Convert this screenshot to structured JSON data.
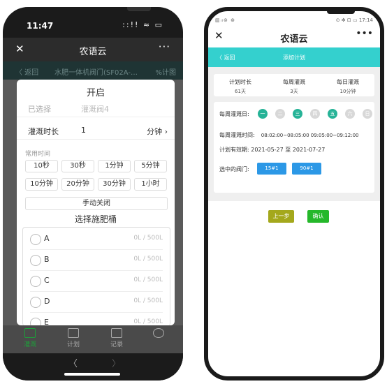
{
  "left": {
    "status": {
      "time": "11:47",
      "icons": "::!! ≈ ▭"
    },
    "titlebar": {
      "close": "✕",
      "title": "农语云",
      "more": "···"
    },
    "navbar": {
      "back": "〈 返回",
      "title": "水肥一体机阀门(SF02A-…",
      "right": "%计图"
    },
    "modal": {
      "title": "开启",
      "selected_label": "已选择",
      "selected_value": "灌溉阀4",
      "duration_label": "灌溉时长",
      "duration_value": "1",
      "duration_unit": "分钟",
      "common_time_label": "常用时间",
      "time_buttons": [
        "10秒",
        "30秒",
        "1分钟",
        "5分钟",
        "10分钟",
        "20分钟",
        "30分钟",
        "1小时"
      ],
      "manual_close": "手动关闭",
      "choose_tank": "选择施肥桶",
      "tanks": [
        {
          "name": "A",
          "capacity": "0L / 500L"
        },
        {
          "name": "B",
          "capacity": "0L / 500L"
        },
        {
          "name": "C",
          "capacity": "0L / 500L"
        },
        {
          "name": "D",
          "capacity": "0L / 500L"
        },
        {
          "name": "E",
          "capacity": "0L / 500L"
        }
      ]
    },
    "tabbar": [
      {
        "label": "灌溉",
        "active": true
      },
      {
        "label": "计划",
        "active": false
      },
      {
        "label": "记录",
        "active": false
      },
      {
        "label": "",
        "active": false
      }
    ],
    "nav_buttons": {
      "back": "〈",
      "forward": "〉"
    }
  },
  "right": {
    "status": {
      "left": "▥ᵢₗ⊜ ⊛",
      "right": "⊙ ✻ ⊡ ▭ 17:14"
    },
    "titlebar": {
      "close": "✕",
      "title": "农语云",
      "more": "•••"
    },
    "navbar": {
      "back": "〈 返回",
      "title": "添加计划"
    },
    "summary": [
      {
        "label": "计划时长",
        "value": "61天"
      },
      {
        "label": "每周灌溉",
        "value": "3天"
      },
      {
        "label": "每日灌溉",
        "value": "10分钟"
      }
    ],
    "weekdays_label": "每周灌溉日:",
    "weekdays": [
      {
        "label": "一",
        "selected": true
      },
      {
        "label": "二",
        "selected": false
      },
      {
        "label": "三",
        "selected": true
      },
      {
        "label": "四",
        "selected": false
      },
      {
        "label": "五",
        "selected": true
      },
      {
        "label": "六",
        "selected": false
      },
      {
        "label": "日",
        "selected": false
      }
    ],
    "weekly_time_label": "每周灌溉时间:",
    "weekly_time_value": "08:02:00~08:05:00  09:05:00~09:12:00",
    "validity": "计划有效期: 2021-05-27 至 2021-07-27",
    "valves_label": "选中的阀门:",
    "valves": [
      "15#1",
      "90#1"
    ],
    "prev_button": "上一步",
    "confirm_button": "确认"
  },
  "colors": {
    "accent_teal": "#34d0ce",
    "day_selected": "#26b397",
    "day_unselected": "#d8d8d8",
    "valve_blue": "#2c98e6",
    "prev_olive": "#a4a81c",
    "confirm_green": "#25b82a",
    "tab_active_green": "#1e9e3a"
  }
}
